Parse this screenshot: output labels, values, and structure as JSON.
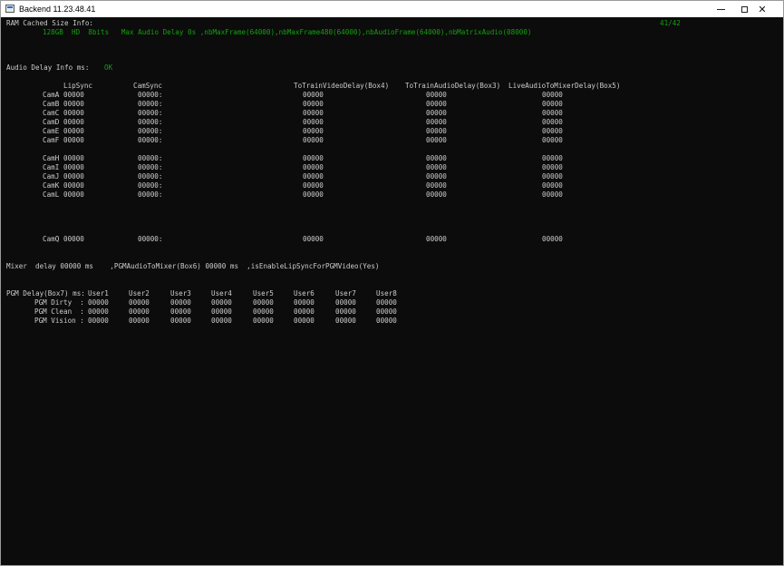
{
  "window": {
    "title": "Backend 11.23.48.41",
    "controls": {
      "minimize": "—",
      "maximize": "☐",
      "close": "✕"
    }
  },
  "header": {
    "ram_label": "RAM Cached Size Info:",
    "ram_info": "128GB  HD  8bits   Max Audio Delay 0s ,nbMaxFrame(64000),nbMaxFrame480(64000),nbAudioFrame(64000),nbMatrixAudio(08000)",
    "counter": "41/42"
  },
  "audio_delay": {
    "label": "Audio Delay Info ms:",
    "status": "OK"
  },
  "cam_table": {
    "headers": {
      "lipsync": "LipSync",
      "camsync": "CamSync",
      "to_train_video": "ToTrainVideoDelay(Box4)",
      "to_train_audio": "ToTrainAudioDelay(Box3)",
      "live_audio": "LiveAudioToMixerDelay(Box5)"
    },
    "rows": [
      {
        "cam": "CamA",
        "lipsync": "00000",
        "camsync": "00000:",
        "video": "00000",
        "audio": "00000",
        "live": "00000"
      },
      {
        "cam": "CamB",
        "lipsync": "00000",
        "camsync": "00000:",
        "video": "00000",
        "audio": "00000",
        "live": "00000"
      },
      {
        "cam": "CamC",
        "lipsync": "00000",
        "camsync": "00000:",
        "video": "00000",
        "audio": "00000",
        "live": "00000"
      },
      {
        "cam": "CamD",
        "lipsync": "00000",
        "camsync": "00000:",
        "video": "00000",
        "audio": "00000",
        "live": "00000"
      },
      {
        "cam": "CamE",
        "lipsync": "00000",
        "camsync": "00000:",
        "video": "00000",
        "audio": "00000",
        "live": "00000"
      },
      {
        "cam": "CamF",
        "lipsync": "00000",
        "camsync": "00000:",
        "video": "00000",
        "audio": "00000",
        "live": "00000"
      },
      {
        "cam": "CamH",
        "lipsync": "00000",
        "camsync": "00000:",
        "video": "00000",
        "audio": "00000",
        "live": "00000"
      },
      {
        "cam": "CamI",
        "lipsync": "00000",
        "camsync": "00000:",
        "video": "00000",
        "audio": "00000",
        "live": "00000"
      },
      {
        "cam": "CamJ",
        "lipsync": "00000",
        "camsync": "00000:",
        "video": "00000",
        "audio": "00000",
        "live": "00000"
      },
      {
        "cam": "CamK",
        "lipsync": "00000",
        "camsync": "00000:",
        "video": "00000",
        "audio": "00000",
        "live": "00000"
      },
      {
        "cam": "CamL",
        "lipsync": "00000",
        "camsync": "00000:",
        "video": "00000",
        "audio": "00000",
        "live": "00000"
      },
      {
        "cam": "CamQ",
        "lipsync": "00000",
        "camsync": "00000:",
        "video": "00000",
        "audio": "00000",
        "live": "00000"
      }
    ]
  },
  "mixer": {
    "line": "Mixer  delay 00000 ms    ,PGMAudioToMixer(Box6) 00000 ms  ,isEnableLipSyncForPGMVideo(Yes)"
  },
  "pgm": {
    "label": "PGM Delay(Box7) ms:",
    "users": [
      "User1",
      "User2",
      "User3",
      "User4",
      "User5",
      "User6",
      "User7",
      "User8"
    ],
    "rows": [
      {
        "label": "PGM Dirty  :",
        "values": [
          "00000",
          "00000",
          "00000",
          "00000",
          "00000",
          "00000",
          "00000",
          "00000"
        ]
      },
      {
        "label": "PGM Clean  :",
        "values": [
          "00000",
          "00000",
          "00000",
          "00000",
          "00000",
          "00000",
          "00000",
          "00000"
        ]
      },
      {
        "label": "PGM Vision :",
        "values": [
          "00000",
          "00000",
          "00000",
          "00000",
          "00000",
          "00000",
          "00000",
          "00000"
        ]
      }
    ]
  },
  "colors": {
    "console_bg": "#0c0c0c",
    "text": "#cccccc",
    "accent_green": "#13a10e"
  }
}
